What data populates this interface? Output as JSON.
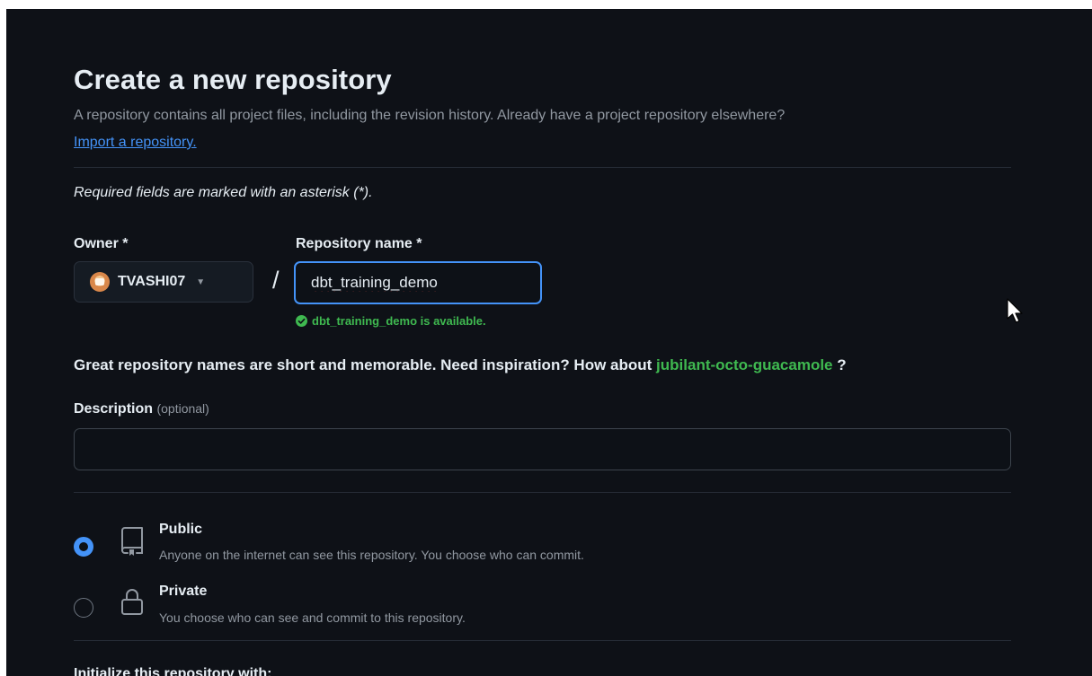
{
  "page": {
    "title": "Create a new repository",
    "subtitle": "A repository contains all project files, including the revision history. Already have a project repository elsewhere?",
    "import_link": "Import a repository.",
    "required_note": "Required fields are marked with an asterisk (*)."
  },
  "owner": {
    "label": "Owner *",
    "value": "TVASHI07"
  },
  "separator": "/",
  "repo_name": {
    "label": "Repository name *",
    "value": "dbt_training_demo",
    "availability": "dbt_training_demo is available."
  },
  "inspiration": {
    "prefix": "Great repository names are short and memorable. Need inspiration? How about",
    "suggestion": "jubilant-octo-guacamole",
    "suffix": "?"
  },
  "description": {
    "label": "Description",
    "optional": "(optional)",
    "value": ""
  },
  "visibility": {
    "options": [
      {
        "title": "Public",
        "description": "Anyone on the internet can see this repository. You choose who can commit.",
        "selected": true,
        "icon": "repo-icon"
      },
      {
        "title": "Private",
        "description": "You choose who can see and commit to this repository.",
        "selected": false,
        "icon": "lock-icon"
      }
    ]
  },
  "initialize_heading": "Initialize this repository with:",
  "colors": {
    "background": "#0e1117",
    "accent": "#4493f8",
    "success": "#3fb950",
    "muted": "#9198a1"
  }
}
